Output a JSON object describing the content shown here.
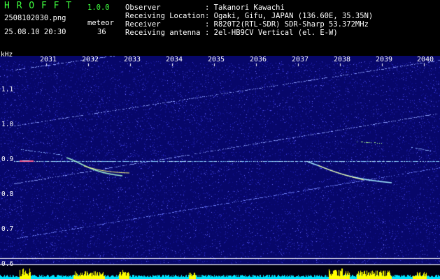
{
  "header": {
    "app_name": "H R O F F T",
    "version": "1.0.0",
    "filename": "2508102030.png",
    "meteor_label": "meteor",
    "datetime": "25.08.10 20:30",
    "meteor_count": "36",
    "info_labels": [
      "Observer",
      "Receiving Location",
      "Receiver",
      "Receiving antenna"
    ],
    "info_values": [
      ": Takanori Kawachi",
      ": Ogaki, Gifu, JAPAN (136.60E, 35.35N)",
      ": R820T2(RTL-SDR) SDR-Sharp 53.372MHz",
      ": 2el-HB9CV Vertical (el. E-W)"
    ]
  },
  "axes": {
    "y_unit": "kHz",
    "y_ticks": [
      "1.1",
      "1.0",
      "0.9",
      "0.8",
      "0.7",
      "0.6"
    ],
    "x_ticks": [
      "2031",
      "2032",
      "2033",
      "2034",
      "2035",
      "2036",
      "2037",
      "2038",
      "2039",
      "2040"
    ]
  },
  "colors": {
    "background": "#000000",
    "plot_background": "#07076a",
    "header_green": "#3fff3f",
    "signal_cyan": "#a8e0ff",
    "meteor_yellow": "#ffff00",
    "level_cyan": "#00e5ff"
  }
}
